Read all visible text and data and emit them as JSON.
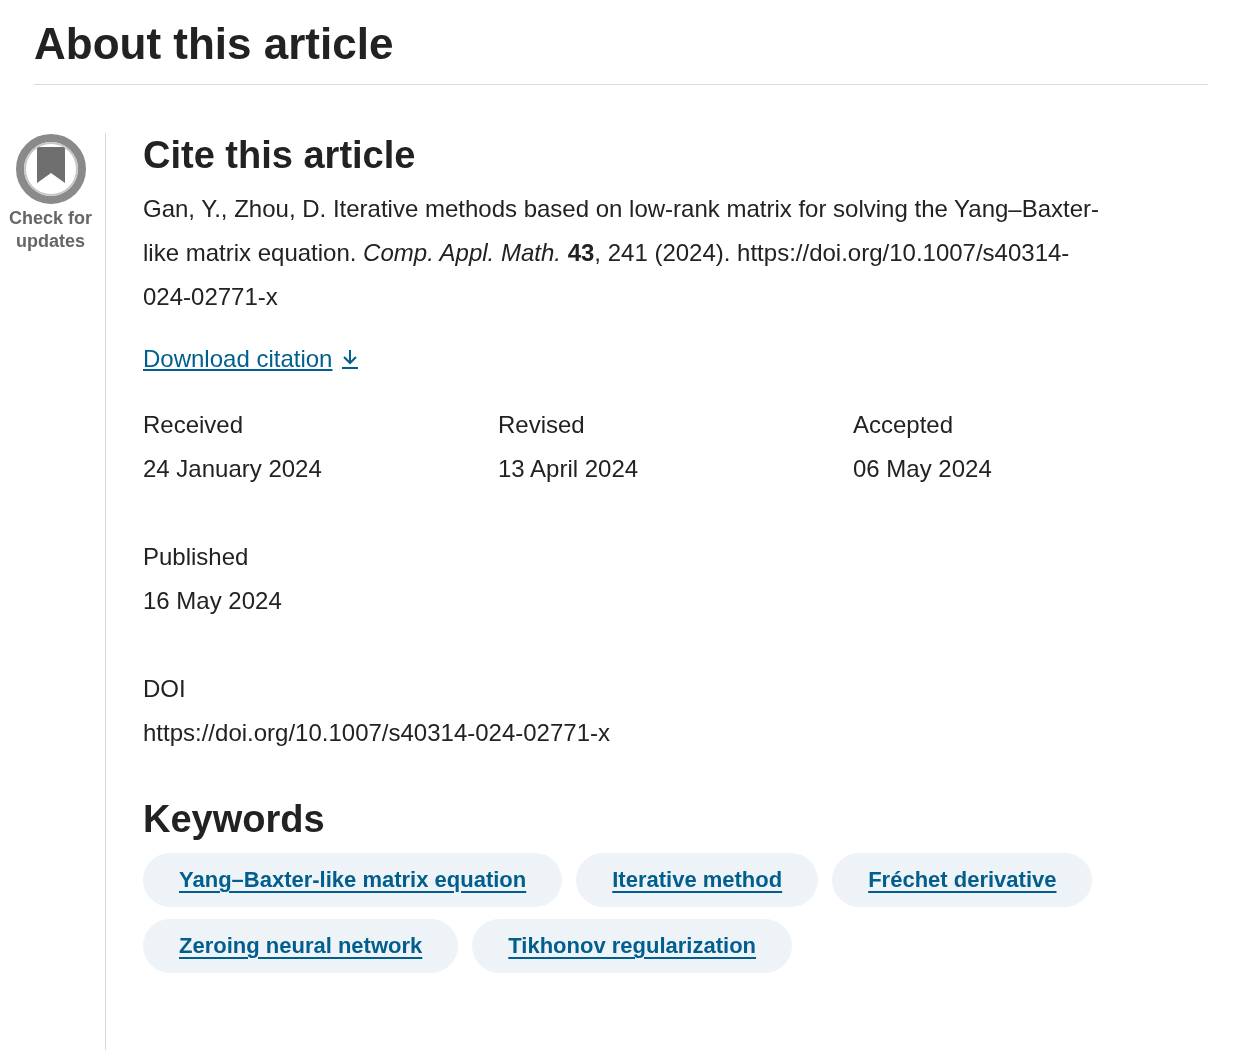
{
  "title": "About this article",
  "badge": {
    "label": "Check for updates"
  },
  "cite": {
    "heading": "Cite this article",
    "citation": "Gan, Y., Zhou, D. Iterative methods based on low-rank matrix for solving the Yang–Baxter-like matrix equation. *Comp. Appl. Math.* **43**, 241 (2024). https://doi.org/10.1007/s40314-024-02771-x",
    "download": "Download citation"
  },
  "dates": [
    {
      "label": "Received",
      "value": "24 January 2024"
    },
    {
      "label": "Revised",
      "value": "13 April 2024"
    },
    {
      "label": "Accepted",
      "value": "06 May 2024"
    },
    {
      "label": "Published",
      "value": "16 May 2024"
    }
  ],
  "doi": {
    "label": "DOI",
    "value": "https://doi.org/10.1007/s40314-024-02771-x"
  },
  "keywords": {
    "heading": "Keywords",
    "items": [
      "Yang–Baxter-like matrix equation",
      "Iterative method",
      "Fréchet derivative",
      "Zeroing neural network",
      "Tikhonov regularization"
    ]
  }
}
